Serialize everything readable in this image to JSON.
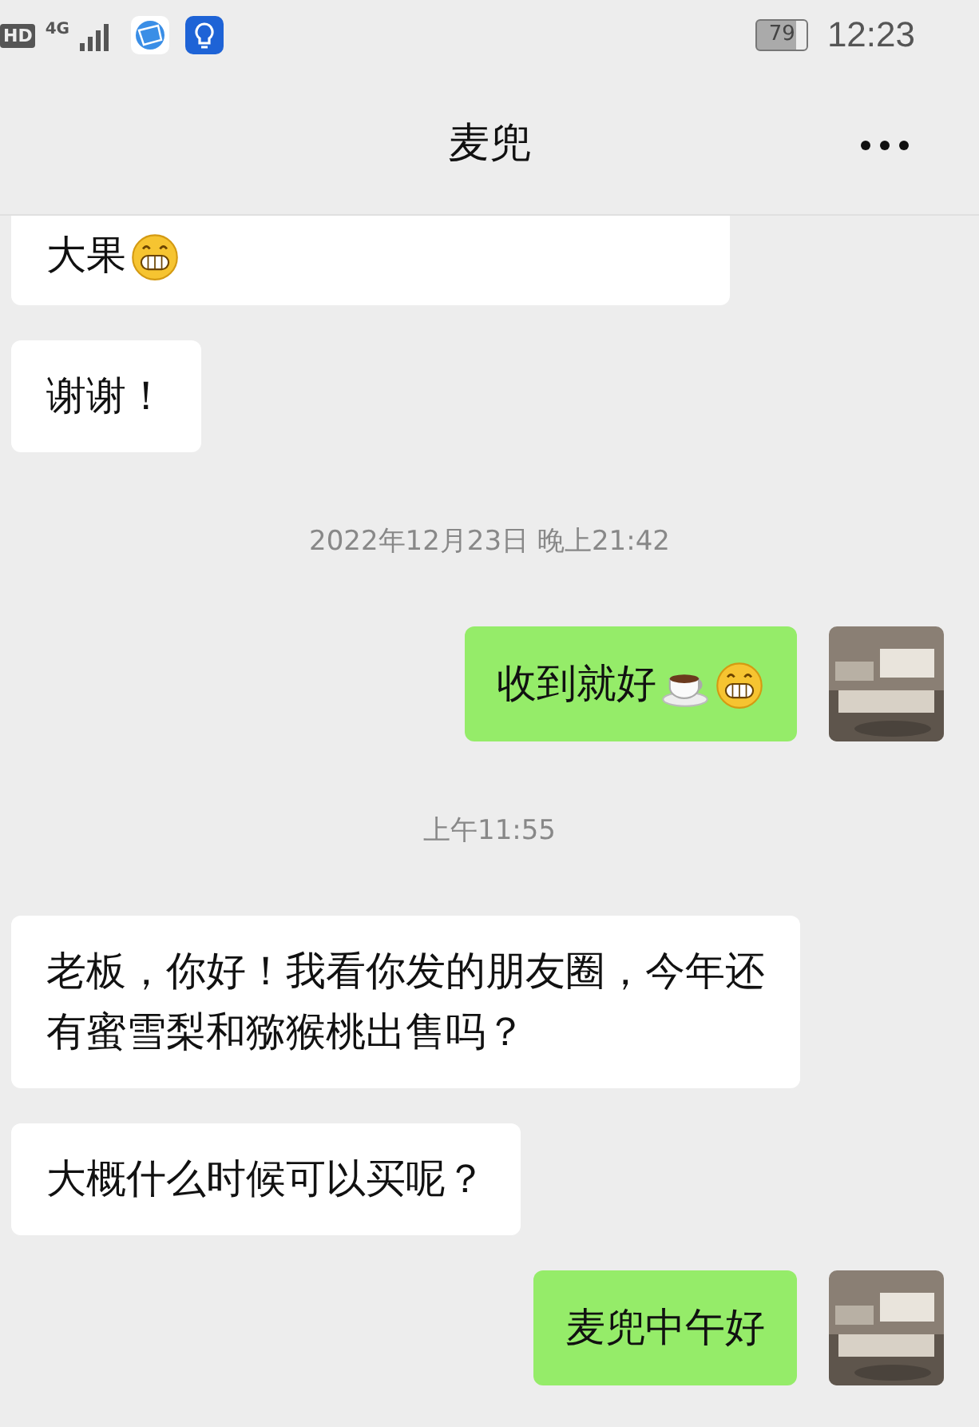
{
  "status_bar": {
    "hd": "HD",
    "network": "4G",
    "battery": "79",
    "time": "12:23"
  },
  "header": {
    "title": "麦兜"
  },
  "messages": [
    {
      "kind": "in",
      "text": "大果",
      "emojis": [
        {
          "kind": "grin"
        }
      ],
      "cut_top": true
    },
    {
      "kind": "in",
      "text": "谢谢！",
      "cut_top": false
    },
    {
      "kind": "time",
      "text": "2022年12月23日 晚上21:42"
    },
    {
      "kind": "out",
      "text": "收到就好",
      "emojis": [
        {
          "kind": "coffee"
        },
        {
          "kind": "grin"
        }
      ],
      "cut_top": false
    },
    {
      "kind": "time",
      "text": "上午11:55"
    },
    {
      "kind": "in",
      "text": "老板，你好！我看你发的朋友圈，今年还有蜜雪梨和猕猴桃出售吗？",
      "cut_top": false
    },
    {
      "kind": "in",
      "text": "大概什么时候可以买呢？",
      "cut_top": false
    },
    {
      "kind": "out",
      "text": "麦兜中午好",
      "cut_top": false
    }
  ]
}
